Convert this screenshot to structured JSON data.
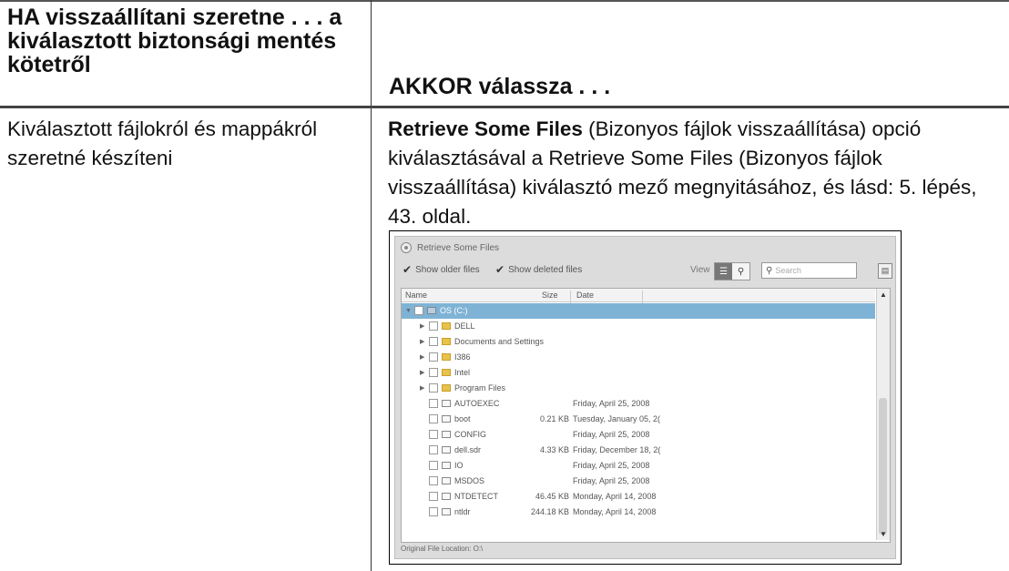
{
  "table": {
    "header_left": "HA visszaállítani szeretne . . . a kiválasztott biztonsági mentés kötetről",
    "header_right": "AKKOR válassza . . .",
    "row_left": "Kiválasztott fájlokról és mappákról szeretné készíteni",
    "row_right_bold": "Retrieve Some Files",
    "row_right_rest": " (Bizonyos fájlok visszaállítása) opció kiválasztásával a Retrieve Some Files (Bizonyos fájlok visszaállítása) kiválasztó mező megnyitásához, és lásd: 5. lépés, 43. oldal."
  },
  "screenshot": {
    "title": "Retrieve Some Files",
    "show_older_label": "Show older files",
    "show_deleted_label": "Show deleted files",
    "view_label": "View",
    "search_placeholder": "Search",
    "columns": {
      "name": "Name",
      "size": "Size",
      "date": "Date"
    },
    "rows": [
      {
        "name": "OS (C:)",
        "size": "",
        "date": ""
      },
      {
        "name": "DELL",
        "size": "",
        "date": ""
      },
      {
        "name": "Documents and Settings",
        "size": "",
        "date": ""
      },
      {
        "name": "I386",
        "size": "",
        "date": ""
      },
      {
        "name": "Intel",
        "size": "",
        "date": ""
      },
      {
        "name": "Program Files",
        "size": "",
        "date": ""
      },
      {
        "name": "AUTOEXEC",
        "size": "",
        "date": "Friday, April 25, 2008"
      },
      {
        "name": "boot",
        "size": "0.21 KB",
        "date": "Tuesday, January 05, 2("
      },
      {
        "name": "CONFIG",
        "size": "",
        "date": "Friday, April 25, 2008"
      },
      {
        "name": "dell.sdr",
        "size": "4.33 KB",
        "date": "Friday, December 18, 2("
      },
      {
        "name": "IO",
        "size": "",
        "date": "Friday, April 25, 2008"
      },
      {
        "name": "MSDOS",
        "size": "",
        "date": "Friday, April 25, 2008"
      },
      {
        "name": "NTDETECT",
        "size": "46.45 KB",
        "date": "Monday, April 14, 2008"
      },
      {
        "name": "ntldr",
        "size": "244.18 KB",
        "date": "Monday, April 14, 2008"
      }
    ],
    "footer": "Original File Location:   O:\\"
  }
}
